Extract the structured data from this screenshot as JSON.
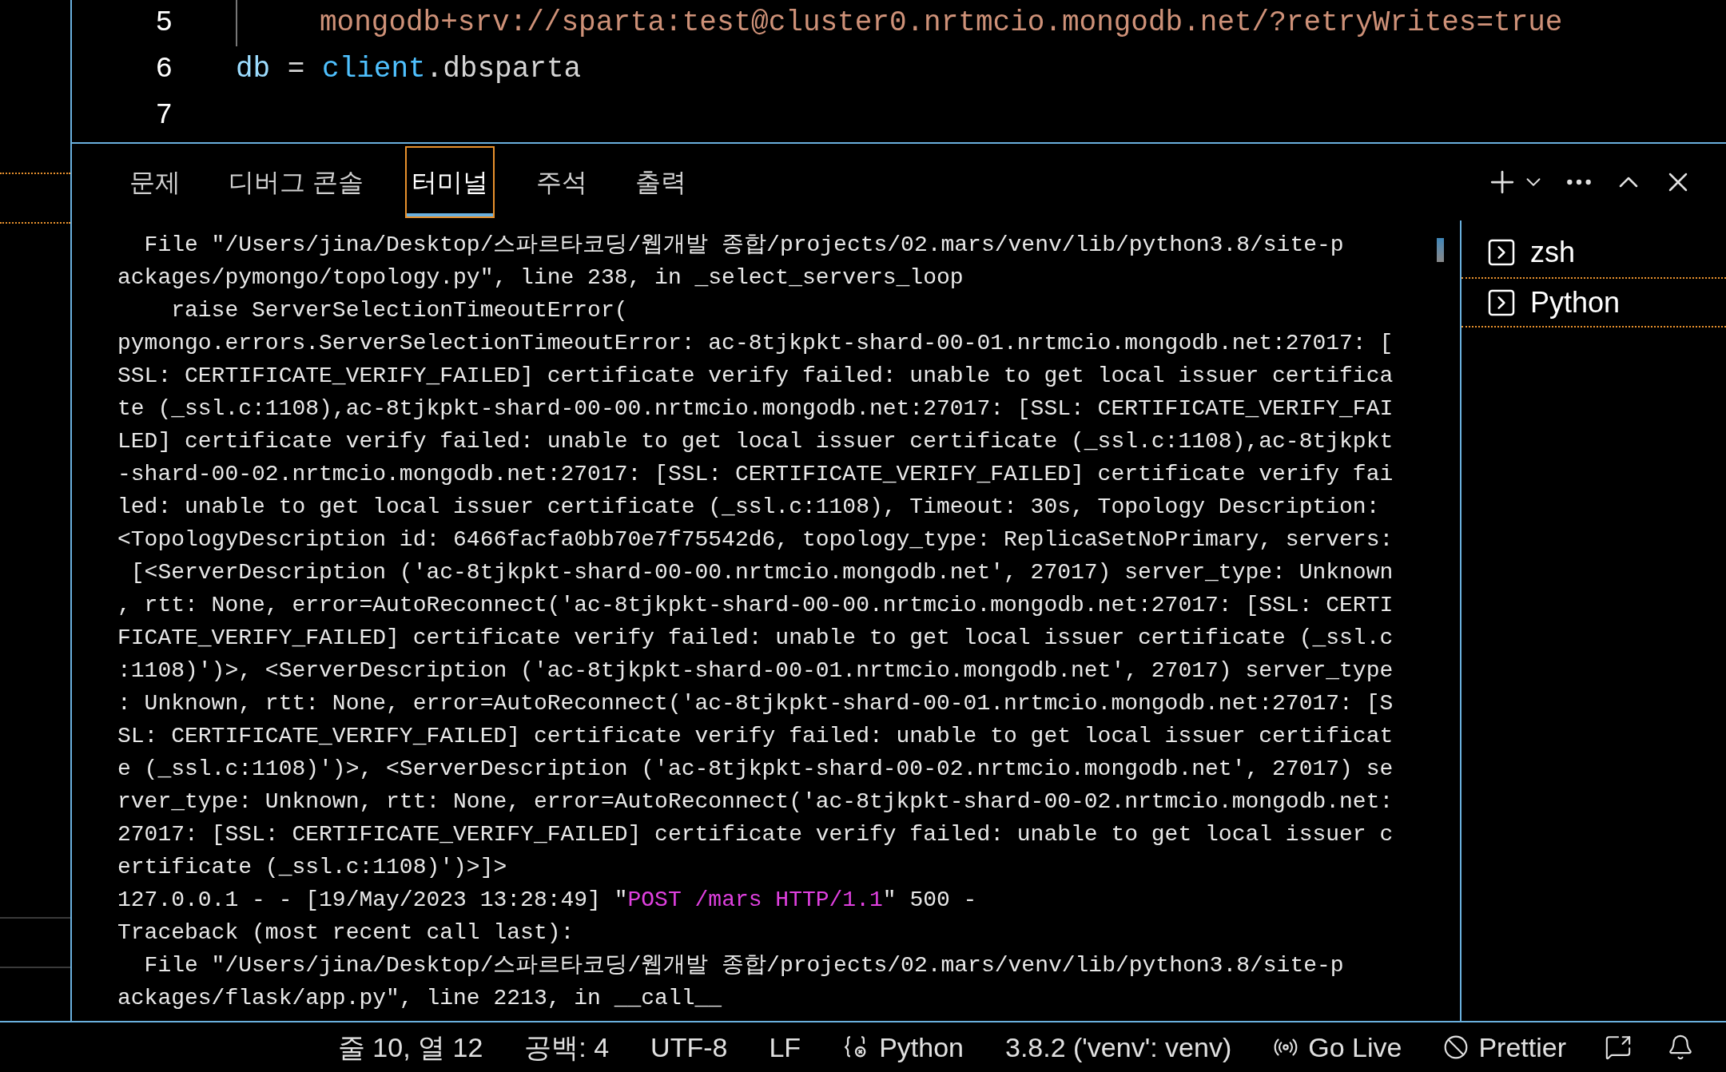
{
  "editor": {
    "lines": [
      {
        "number": "5",
        "guide": true,
        "tokens": [
          {
            "kind": "string",
            "text": "mongodb+srv://sparta:test@cluster0.nrtmcio.mongodb.net/?retryWrites=true"
          }
        ]
      },
      {
        "number": "6",
        "guide": false,
        "tokens": [
          {
            "kind": "variable",
            "text": "db"
          },
          {
            "kind": "plain",
            "text": " = "
          },
          {
            "kind": "object",
            "text": "client"
          },
          {
            "kind": "plain",
            "text": ".dbsparta"
          }
        ]
      },
      {
        "number": "7",
        "guide": false
      }
    ]
  },
  "panel": {
    "tabs": [
      {
        "label": "문제",
        "selected": false
      },
      {
        "label": "디버그 콘솔",
        "selected": false
      },
      {
        "label": "터미널",
        "selected": true
      },
      {
        "label": "주석",
        "selected": false
      },
      {
        "label": "출력",
        "selected": false
      }
    ]
  },
  "terminal": {
    "lines": [
      {
        "kind": "plain",
        "text": "  File \"/Users/jina/Desktop/스파르타코딩/웹개발 종합/projects/02.mars/venv/lib/python3.8/site-p"
      },
      {
        "kind": "plain",
        "text": "ackages/pymongo/topology.py\", line 238, in _select_servers_loop"
      },
      {
        "kind": "plain",
        "text": "    raise ServerSelectionTimeoutError("
      },
      {
        "kind": "plain",
        "text": "pymongo.errors.ServerSelectionTimeoutError: ac-8tjkpkt-shard-00-01.nrtmcio.mongodb.net:27017: ["
      },
      {
        "kind": "plain",
        "text": "SSL: CERTIFICATE_VERIFY_FAILED] certificate verify failed: unable to get local issuer certifica"
      },
      {
        "kind": "plain",
        "text": "te (_ssl.c:1108),ac-8tjkpkt-shard-00-00.nrtmcio.mongodb.net:27017: [SSL: CERTIFICATE_VERIFY_FAI"
      },
      {
        "kind": "plain",
        "text": "LED] certificate verify failed: unable to get local issuer certificate (_ssl.c:1108),ac-8tjkpkt"
      },
      {
        "kind": "plain",
        "text": "-shard-00-02.nrtmcio.mongodb.net:27017: [SSL: CERTIFICATE_VERIFY_FAILED] certificate verify fai"
      },
      {
        "kind": "plain",
        "text": "led: unable to get local issuer certificate (_ssl.c:1108), Timeout: 30s, Topology Description:"
      },
      {
        "kind": "plain",
        "text": "<TopologyDescription id: 6466facfa0bb70e7f75542d6, topology_type: ReplicaSetNoPrimary, servers:"
      },
      {
        "kind": "plain",
        "text": " [<ServerDescription ('ac-8tjkpkt-shard-00-00.nrtmcio.mongodb.net', 27017) server_type: Unknown"
      },
      {
        "kind": "plain",
        "text": ", rtt: None, error=AutoReconnect('ac-8tjkpkt-shard-00-00.nrtmcio.mongodb.net:27017: [SSL: CERTI"
      },
      {
        "kind": "plain",
        "text": "FICATE_VERIFY_FAILED] certificate verify failed: unable to get local issuer certificate (_ssl.c"
      },
      {
        "kind": "plain",
        "text": ":1108)')>, <ServerDescription ('ac-8tjkpkt-shard-00-01.nrtmcio.mongodb.net', 27017) server_type"
      },
      {
        "kind": "plain",
        "text": ": Unknown, rtt: None, error=AutoReconnect('ac-8tjkpkt-shard-00-01.nrtmcio.mongodb.net:27017: [S"
      },
      {
        "kind": "plain",
        "text": "SL: CERTIFICATE_VERIFY_FAILED] certificate verify failed: unable to get local issuer certificat"
      },
      {
        "kind": "plain",
        "text": "e (_ssl.c:1108)')>, <ServerDescription ('ac-8tjkpkt-shard-00-02.nrtmcio.mongodb.net', 27017) se"
      },
      {
        "kind": "plain",
        "text": "rver_type: Unknown, rtt: None, error=AutoReconnect('ac-8tjkpkt-shard-00-02.nrtmcio.mongodb.net:"
      },
      {
        "kind": "plain",
        "text": "27017: [SSL: CERTIFICATE_VERIFY_FAILED] certificate verify failed: unable to get local issuer c"
      },
      {
        "kind": "plain",
        "text": "ertificate (_ssl.c:1108)')>]>"
      },
      {
        "kind": "request",
        "prefix": "127.0.0.1 - - [19/May/2023 13:28:49] \"",
        "highlight": "POST /mars HTTP/1.1",
        "suffix": "\" 500 -"
      },
      {
        "kind": "plain",
        "text": "Traceback (most recent call last):"
      },
      {
        "kind": "plain",
        "text": "  File \"/Users/jina/Desktop/스파르타코딩/웹개발 종합/projects/02.mars/venv/lib/python3.8/site-p"
      },
      {
        "kind": "plain",
        "text": "ackages/flask/app.py\", line 2213, in __call__"
      }
    ],
    "sessions": [
      {
        "name": "zsh",
        "selected": false
      },
      {
        "name": "Python",
        "selected": true
      }
    ]
  },
  "status_bar": [
    {
      "kind": "text",
      "label": "줄 10, 열 12"
    },
    {
      "kind": "text",
      "label": "공백: 4"
    },
    {
      "kind": "text",
      "label": "UTF-8"
    },
    {
      "kind": "text",
      "label": "LF"
    },
    {
      "kind": "language",
      "label": "Python"
    },
    {
      "kind": "text",
      "label": "3.8.2 ('venv': venv)"
    },
    {
      "kind": "golive",
      "label": "Go Live"
    },
    {
      "kind": "prettier",
      "label": "Prettier"
    },
    {
      "kind": "feedback"
    },
    {
      "kind": "bell"
    }
  ]
}
